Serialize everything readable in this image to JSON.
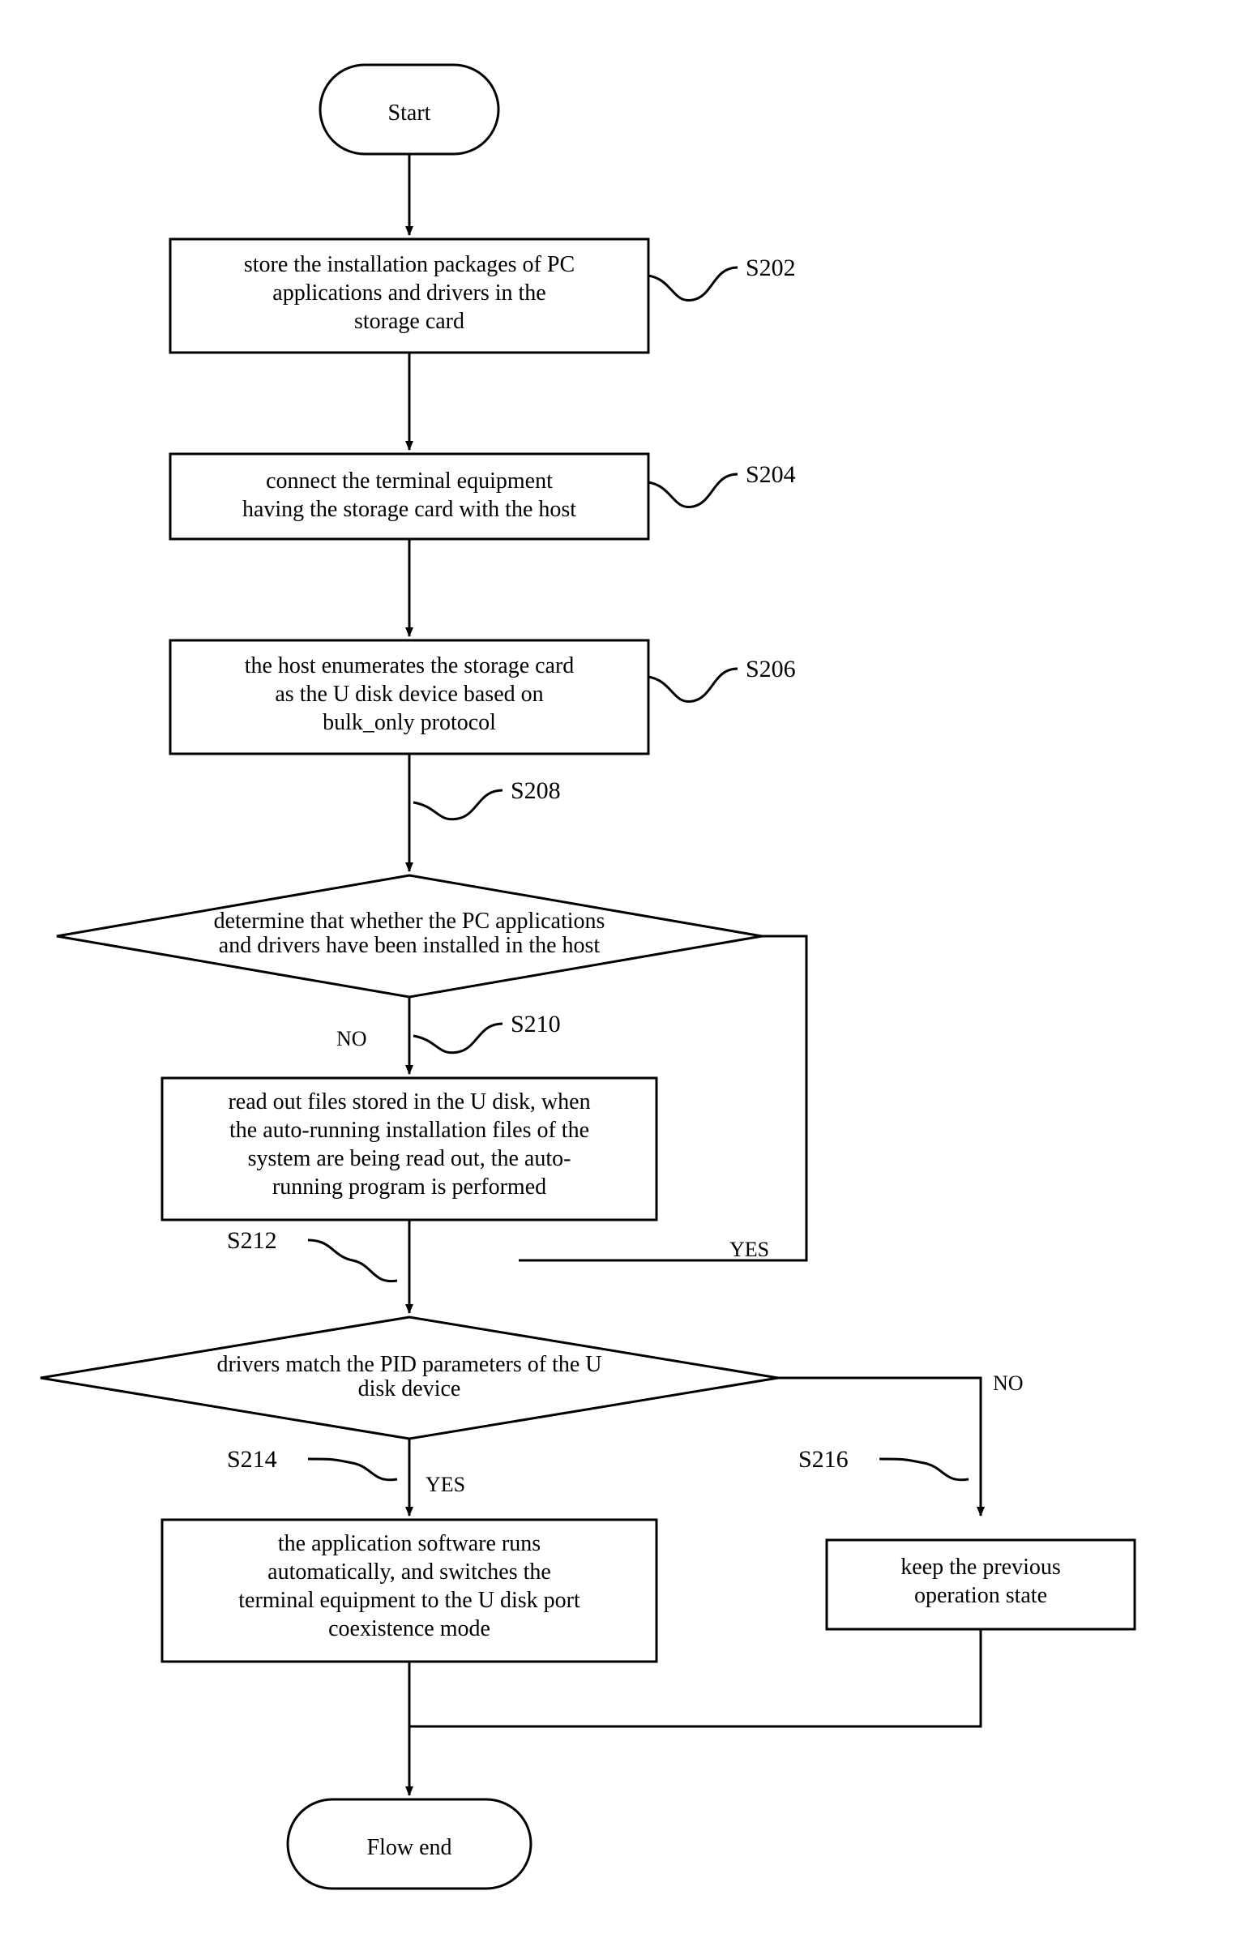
{
  "chart_data": {
    "type": "flowchart",
    "nodes": [
      {
        "id": "start",
        "shape": "terminator",
        "text": "Start"
      },
      {
        "id": "s202",
        "shape": "process",
        "label": "S202",
        "text": "store the installation packages of PC applications and drivers in the storage card"
      },
      {
        "id": "s204",
        "shape": "process",
        "label": "S204",
        "text": "connect the terminal equipment having the storage card with the host"
      },
      {
        "id": "s206",
        "shape": "process",
        "label": "S206",
        "text": "the host enumerates the storage card as the U disk device based on bulk_only protocol"
      },
      {
        "id": "s208",
        "shape": "decision",
        "label": "S208",
        "text": "determine that whether the PC applications and drivers have been installed in the host"
      },
      {
        "id": "s210",
        "shape": "process",
        "label": "S210",
        "text": "read out files stored in the U disk, when the auto-running installation files of the system are being read out, the auto-running program is performed"
      },
      {
        "id": "s212",
        "shape": "decision",
        "label": "S212",
        "text": "drivers match the PID parameters of the U disk device"
      },
      {
        "id": "s214",
        "shape": "process",
        "label": "S214",
        "text": "the application software runs automatically, and switches the terminal equipment to the U disk port coexistence mode"
      },
      {
        "id": "s216",
        "shape": "process",
        "label": "S216",
        "text": "keep the previous operation state"
      },
      {
        "id": "end",
        "shape": "terminator",
        "text": "Flow end"
      }
    ],
    "edges": [
      {
        "from": "start",
        "to": "s202"
      },
      {
        "from": "s202",
        "to": "s204"
      },
      {
        "from": "s204",
        "to": "s206"
      },
      {
        "from": "s206",
        "to": "s208"
      },
      {
        "from": "s208",
        "to": "s210",
        "label": "NO"
      },
      {
        "from": "s208",
        "to": "s212",
        "label": "YES"
      },
      {
        "from": "s210",
        "to": "s212"
      },
      {
        "from": "s212",
        "to": "s214",
        "label": "YES"
      },
      {
        "from": "s212",
        "to": "s216",
        "label": "NO"
      },
      {
        "from": "s214",
        "to": "end"
      },
      {
        "from": "s216",
        "to": "end"
      }
    ]
  },
  "start": {
    "text": "Start"
  },
  "end": {
    "text": "Flow end"
  },
  "s202": {
    "label": "S202",
    "line1": "store the installation packages of PC",
    "line2": "applications and drivers in the",
    "line3": "storage card"
  },
  "s204": {
    "label": "S204",
    "line1": "connect the terminal equipment",
    "line2": "having the storage card with the host"
  },
  "s206": {
    "label": "S206",
    "line1": "the host enumerates the storage card",
    "line2": "as the U disk device based on",
    "line3": "bulk_only protocol"
  },
  "s208": {
    "label": "S208",
    "line1": "determine that whether the PC applications",
    "line2": "and drivers have been installed in the host"
  },
  "s210": {
    "label": "S210",
    "line1": "read out files stored in the U disk, when",
    "line2": "the auto-running installation files of the",
    "line3": "system are being read out, the auto-",
    "line4": "running program is performed"
  },
  "s212": {
    "label": "S212",
    "line1": "drivers match the PID parameters of the U",
    "line2": "disk device"
  },
  "s214": {
    "label": "S214",
    "line1": "the application software runs",
    "line2": "automatically, and switches the",
    "line3": "terminal equipment to the U disk port",
    "line4": "coexistence mode"
  },
  "s216": {
    "label": "S216",
    "line1": "keep the previous",
    "line2": "operation state"
  },
  "branch": {
    "no": "NO",
    "yes": "YES"
  }
}
